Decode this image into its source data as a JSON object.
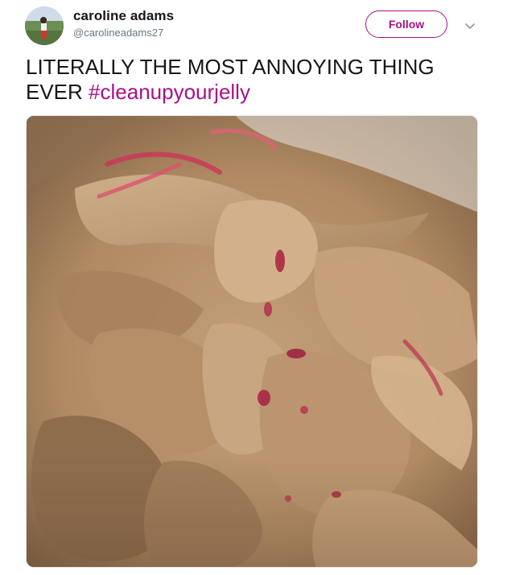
{
  "user": {
    "name": "caroline adams",
    "handle": "@carolineadams27",
    "avatar_icon": "profile-photo"
  },
  "follow_button": {
    "label": "Follow"
  },
  "menu": {
    "icon": "chevron-down-icon"
  },
  "tweet": {
    "text": "LITERALLY THE MOST ANNOYING THING EVER",
    "hashtag": "#cleanupyourjelly"
  },
  "media": {
    "description_icon": "photo-peanut-butter-jar"
  },
  "colors": {
    "accent": "#a8108a",
    "text": "#14171a",
    "secondary_text": "#657786"
  }
}
